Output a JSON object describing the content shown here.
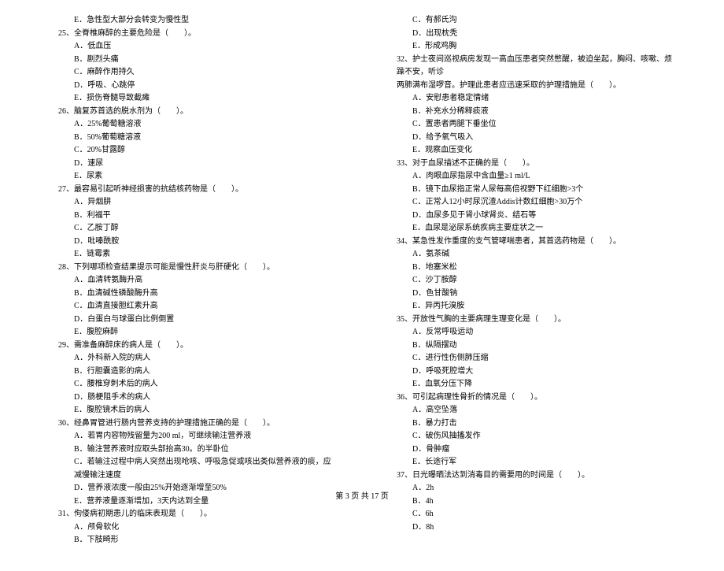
{
  "left": {
    "pre_options": [
      "E．急性型大部分会转变为慢性型"
    ],
    "questions": [
      {
        "num": "25、",
        "stem": "全脊椎麻醉的主要危险是（　　）。",
        "options": [
          "A．低血压",
          "B．剧烈头痛",
          "C．麻醉作用持久",
          "D．呼吸、心跳停",
          "E．损伤脊髓导致截瘫"
        ]
      },
      {
        "num": "26、",
        "stem": "脑复苏首选的脱水剂为（　　）。",
        "options": [
          "A．25%葡萄糖溶液",
          "B．50%葡萄糖溶液",
          "C．20%甘露醇",
          "D．速尿",
          "E．尿素"
        ]
      },
      {
        "num": "27、",
        "stem": "最容易引起听神经损害的抗结核药物是（　　）。",
        "options": [
          "A．异烟肼",
          "B．利福平",
          "C．乙胺丁醇",
          "D．吡嗪酰胺",
          "E．链霉素"
        ]
      },
      {
        "num": "28、",
        "stem": "下列哪项检查结果提示可能是慢性肝炎与肝硬化（　　）。",
        "options": [
          "A．血清转氨酶升高",
          "B．血清碱性磷酸酶升高",
          "C．血清直接胆红素升高",
          "D．白蛋白与球蛋白比例倒置",
          "E．腹腔麻醉"
        ]
      },
      {
        "num": "29、",
        "stem": "需准备麻醉床的病人是（　　）。",
        "options": [
          "A．外科新入院的病人",
          "B．行胆囊造影的病人",
          "C．腰椎穿刺术后的病人",
          "D．肠梗阻手术的病人",
          "E．腹腔镜术后的病人"
        ]
      },
      {
        "num": "30、",
        "stem": "经鼻胃管进行肠内营养支持的护理措施正确的是（　　）。",
        "options": [
          "A．若胃内容物残留量为200 ml，可继续输注营养液",
          "B．输注营养液时应取头部抬高30。的半卧位",
          "C．若输注过程中病人突然出现呛咳、呼吸急促或咳出类似营养液的痰，应减慢输注速度",
          "D．营养液浓度一般由25%开始逐渐增至50%",
          "E．营养液量逐渐增加，3天内达到全量"
        ]
      },
      {
        "num": "31、",
        "stem": "佝偻病初期患儿的临床表现是（　　）。",
        "options": [
          "A．颅骨软化",
          "B．下肢畸形"
        ]
      }
    ]
  },
  "right": {
    "pre_options": [
      "C．有郝氏沟",
      "D．出现枕秃",
      "E．形成鸡胸"
    ],
    "questions": [
      {
        "num": "32、",
        "stem": "护士夜间巡视病房发现一高血压患者突然憋醒，被迫坐起，胸闷、咳嗽、烦躁不安，听诊",
        "stem2": "两肺满布湿啰音。护理此患者应迅速采取的护理措施是（　　）。",
        "options": [
          "A．安慰患者稳定情绪",
          "B．补充水分稀释痰液",
          "C．置患者两腿下垂坐位",
          "D．给予氧气吸入",
          "E．观察血压变化"
        ]
      },
      {
        "num": "33、",
        "stem": "对于血尿描述不正确的是（　　）。",
        "options": [
          "A．肉眼血尿指尿中含血量≥1 ml/L",
          "B．镜下血尿指正常人尿每高倍视野下红细胞>3个",
          "C．正常人12小时尿沉渣Addis计数红细胞>30万个",
          "D．血尿多见于肾小球肾炎、结石等",
          "E．血尿是泌尿系统疾病主要症状之一"
        ]
      },
      {
        "num": "34、",
        "stem": "某急性发作重度的支气管哮喘患者，其首选药物是（　　）。",
        "options": [
          "A．氨茶碱",
          "B．地塞米松",
          "C．沙丁胺醇",
          "D．色甘酸钠",
          "E．异丙托溴胺"
        ]
      },
      {
        "num": "35、",
        "stem": "开放性气胸的主要病理生理变化是（　　）。",
        "options": [
          "A．反常呼吸运动",
          "B．纵隔摆动",
          "C．进行性伤侧肺压缩",
          "D．呼吸死腔增大",
          "E．血氧分压下降"
        ]
      },
      {
        "num": "36、",
        "stem": "可引起病理性骨折的情况是（　　）。",
        "options": [
          "A．高空坠落",
          "B．暴力打击",
          "C．破伤风抽搐发作",
          "D．骨肿瘤",
          "E．长途行军"
        ]
      },
      {
        "num": "37、",
        "stem": "日光曝晒法达到消毒目的需要用的时间是（　　）。",
        "options": [
          "A．2h",
          "B．4h",
          "C．6h",
          "D．8h"
        ]
      }
    ]
  },
  "footer": "第 3 页 共 17 页"
}
